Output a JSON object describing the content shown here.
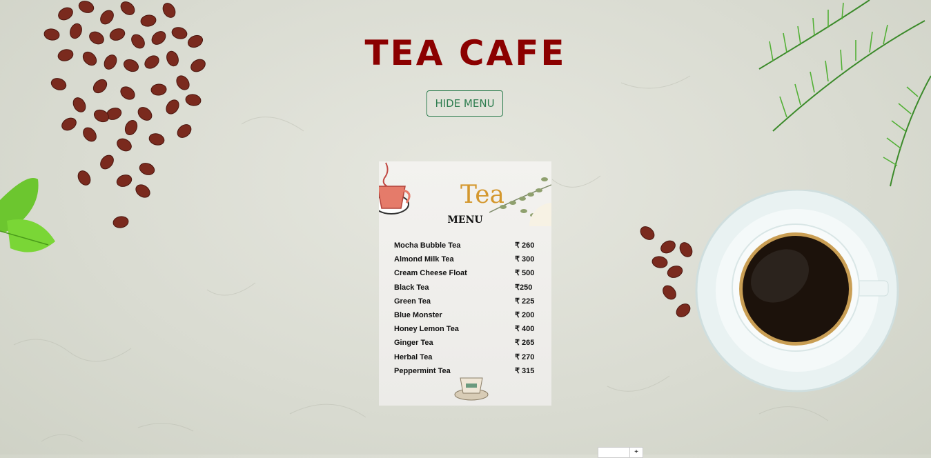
{
  "header": {
    "title": "TEA CAFE"
  },
  "toggle_button": {
    "label": "HIDE MENU"
  },
  "menu_card": {
    "title": "Tea",
    "subtitle": "MENU",
    "items": [
      {
        "name": "Mocha Bubble Tea",
        "price": "₹ 260"
      },
      {
        "name": "Almond Milk Tea",
        "price": "₹ 300"
      },
      {
        "name": "Cream Cheese Float",
        "price": "₹ 500"
      },
      {
        "name": "Black Tea",
        "price": "₹250"
      },
      {
        "name": "Green Tea",
        "price": "₹ 225"
      },
      {
        "name": "Blue Monster",
        "price": "₹ 200"
      },
      {
        "name": "Honey Lemon Tea",
        "price": "₹ 400"
      },
      {
        "name": "Ginger Tea",
        "price": "₹  265"
      },
      {
        "name": "Herbal Tea",
        "price": "₹ 270"
      },
      {
        "name": "Peppermint Tea",
        "price": "₹ 315"
      }
    ]
  },
  "stepper": {
    "plus_label": "+"
  },
  "colors": {
    "title": "#8b0000",
    "button": "#2e7d4f",
    "menu_title": "#d4972d"
  }
}
